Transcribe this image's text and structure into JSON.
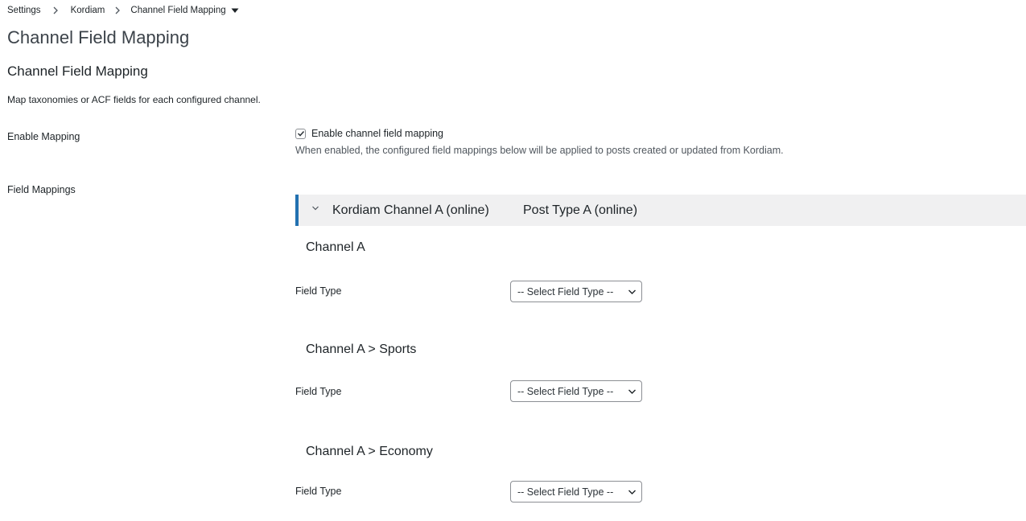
{
  "breadcrumb": {
    "items": [
      "Settings",
      "Kordiam",
      "Channel Field Mapping"
    ]
  },
  "page": {
    "title": "Channel Field Mapping",
    "section_title": "Channel Field Mapping",
    "section_description": "Map taxonomies or ACF fields for each configured channel."
  },
  "enable_mapping": {
    "label": "Enable Mapping",
    "checkbox_label": "Enable channel field mapping",
    "checked": true,
    "help": "When enabled, the configured field mappings below will be applied to posts created or updated from Kordiam."
  },
  "field_mappings": {
    "label": "Field Mappings",
    "accordion": {
      "channel": "Kordiam Channel A (online)",
      "post_type": "Post Type A (online)",
      "expanded": true
    },
    "channels": [
      {
        "heading": "Channel A",
        "field_label": "Field Type",
        "select_value": "-- Select Field Type --"
      },
      {
        "heading": "Channel A > Sports",
        "field_label": "Field Type",
        "select_value": "-- Select Field Type --"
      },
      {
        "heading": "Channel A > Economy",
        "field_label": "Field Type",
        "select_value": "-- Select Field Type --"
      }
    ]
  },
  "colors": {
    "accent": "#2271b1",
    "accordion_bg": "#f0f0f1",
    "text": "#1d2327"
  }
}
